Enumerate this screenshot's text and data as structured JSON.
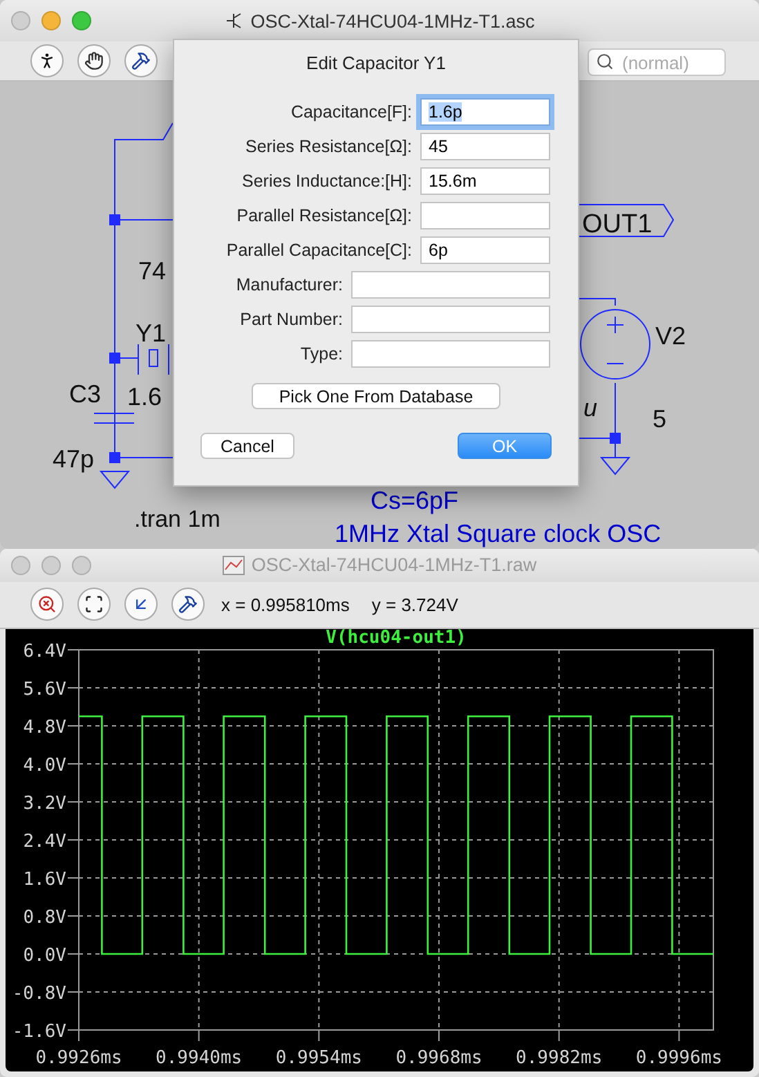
{
  "schematic_window": {
    "title": "OSC-Xtal-74HCU04-1MHz-T1.asc",
    "search": {
      "placeholder": "(normal)"
    },
    "labels": [
      "OUT1",
      "74",
      "Y1",
      "V2",
      "C3",
      "1.6",
      "u",
      "5",
      "47p",
      "Cs=6pF",
      ".tran 1m",
      "1MHz Xtal Square clock OSC"
    ]
  },
  "dialog": {
    "title": "Edit Capacitor Y1",
    "fields": [
      {
        "kind": "electrical",
        "label": "Capacitance[F]:",
        "value": "1.6p",
        "focused": true
      },
      {
        "kind": "electrical",
        "label": "Series Resistance[Ω]:",
        "value": "45",
        "focused": false
      },
      {
        "kind": "electrical",
        "label": "Series Inductance:[H]:",
        "value": "15.6m",
        "focused": false
      },
      {
        "kind": "electrical",
        "label": "Parallel Resistance[Ω]:",
        "focused": false
      },
      {
        "kind": "electrical",
        "label": "Parallel Capacitance[C]:",
        "value": "6p",
        "focused": false
      },
      {
        "kind": "part",
        "label": "Manufacturer:",
        "focused": false
      },
      {
        "kind": "part",
        "label": "Part Number:",
        "focused": false
      },
      {
        "kind": "part",
        "label": "Type:",
        "focused": false
      }
    ],
    "database_button": "Pick One From Database",
    "buttons": [
      {
        "label": "Cancel",
        "default": false
      },
      {
        "label": "OK",
        "default": true
      }
    ]
  },
  "waveform_window": {
    "title": "OSC-Xtal-74HCU04-1MHz-T1.raw",
    "cursor_x": "x = 0.995810ms",
    "cursor_y": "y = 3.724V",
    "chart_data": {
      "type": "line",
      "grid": true,
      "xlim": [
        0.9926,
        1.0
      ],
      "ylim": [
        -1.6,
        6.4
      ],
      "xticks": [
        {
          "value": 0.9926,
          "label": "0.9926ms"
        },
        {
          "value": 0.994,
          "label": "0.9940ms"
        },
        {
          "value": 0.9954,
          "label": "0.9954ms"
        },
        {
          "value": 0.9968,
          "label": "0.9968ms"
        },
        {
          "value": 0.9982,
          "label": "0.9982ms"
        },
        {
          "value": 0.9996,
          "label": "0.9996ms"
        }
      ],
      "yticks": [
        {
          "value": 6.4,
          "label": "6.4V"
        },
        {
          "value": 5.6,
          "label": "5.6V"
        },
        {
          "value": 4.8,
          "label": "4.8V"
        },
        {
          "value": 4.0,
          "label": "4.0V"
        },
        {
          "value": 3.2,
          "label": "3.2V"
        },
        {
          "value": 2.4,
          "label": "2.4V"
        },
        {
          "value": 1.6,
          "label": "1.6V"
        },
        {
          "value": 0.8,
          "label": "0.8V"
        },
        {
          "value": 0.0,
          "label": "0.0V"
        },
        {
          "value": -0.8,
          "label": "-0.8V"
        },
        {
          "value": -1.6,
          "label": "-1.6V"
        }
      ],
      "x": [
        0.9926,
        0.99287,
        0.99287,
        0.99334,
        0.99334,
        0.99382,
        0.99382,
        0.99429,
        0.99429,
        0.99477,
        0.99477,
        0.99524,
        0.99524,
        0.99572,
        0.99572,
        0.99619,
        0.99619,
        0.99667,
        0.99667,
        0.99714,
        0.99714,
        0.99762,
        0.99762,
        0.99809,
        0.99809,
        0.99857,
        0.99857,
        0.99904,
        0.99904,
        0.99952,
        0.99952,
        1.0
      ],
      "series": [
        {
          "name": "V(hcu04-out1)",
          "color": "#3ef03e",
          "values": [
            5.0,
            5.0,
            0.0,
            0.0,
            5.0,
            5.0,
            0.0,
            0.0,
            5.0,
            5.0,
            0.0,
            0.0,
            5.0,
            5.0,
            0.0,
            0.0,
            5.0,
            5.0,
            0.0,
            0.0,
            5.0,
            5.0,
            0.0,
            0.0,
            5.0,
            5.0,
            0.0,
            0.0,
            5.0,
            5.0,
            0.0,
            0.0
          ]
        }
      ]
    }
  }
}
